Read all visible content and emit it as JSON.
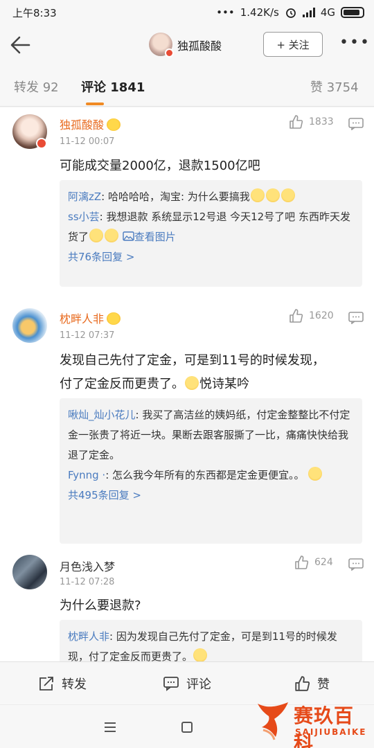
{
  "status": {
    "time": "上午8:33",
    "dots": "•••",
    "speed": "1.42K/s",
    "network": "4G"
  },
  "nav": {
    "title": "独孤酸酸",
    "follow": "+ 关注",
    "more": "•••"
  },
  "tabs": {
    "repost": "转发 92",
    "comment": "评论 1841",
    "like": "赞 3754"
  },
  "comments": [
    {
      "name": "独孤酸酸",
      "time": "11-12 00:07",
      "likes": "1833",
      "text": "可能成交量2000亿，退款1500亿吧",
      "replies": [
        {
          "name": "阿漓zZ",
          "text": ": 哈哈哈哈，淘宝: 为什么要搞我"
        },
        {
          "name": "ss小芸",
          "text": ": 我想退款 系统显示12号退 今天12号了吧 东西昨天发货了",
          "link": "查看图片"
        }
      ],
      "more": "共76条回复 >"
    },
    {
      "name": "枕畔人非",
      "time": "11-12 07:37",
      "likes": "1620",
      "text_line1": "发现自己先付了定金，可是到11号的时候发现，",
      "text_line2": "付了定金反而更贵了。",
      "text_tail": "悦诗某吟",
      "replies": [
        {
          "name": "啾灿_灿小花儿",
          "text": ": 我买了高洁丝的姨妈纸，付定金整整比不付定金一张贵了将近一块。果断去跟客服撕了一比，痛痛快快给我退了定金。"
        },
        {
          "name": "Fynng ·",
          "text": ": 怎么我今年所有的东西都是定金更便宜。。"
        }
      ],
      "more": "共495条回复 >"
    },
    {
      "name": "月色浅入梦",
      "time": "11-12 07:28",
      "likes": "624",
      "text": "为什么要退款?",
      "replies": [
        {
          "name": "枕畔人非",
          "text": ": 因为发现自己先付了定金，可是到11号的时候发现，付了定金反而更贵了。"
        }
      ]
    }
  ],
  "actions": {
    "repost": "转发",
    "comment": "评论",
    "like": "赞"
  },
  "watermark": {
    "text": "赛玖百科",
    "sub": "SAIJIUBAIKE"
  },
  "icons": [
    "back-arrow-icon",
    "thumb-up-icon",
    "reply-icon",
    "share-icon",
    "comment-icon",
    "menu-icon",
    "home-icon"
  ],
  "colors": {
    "accent": "#f08a24",
    "link": "#4a7bbf",
    "vip_name": "#e86a1e"
  }
}
